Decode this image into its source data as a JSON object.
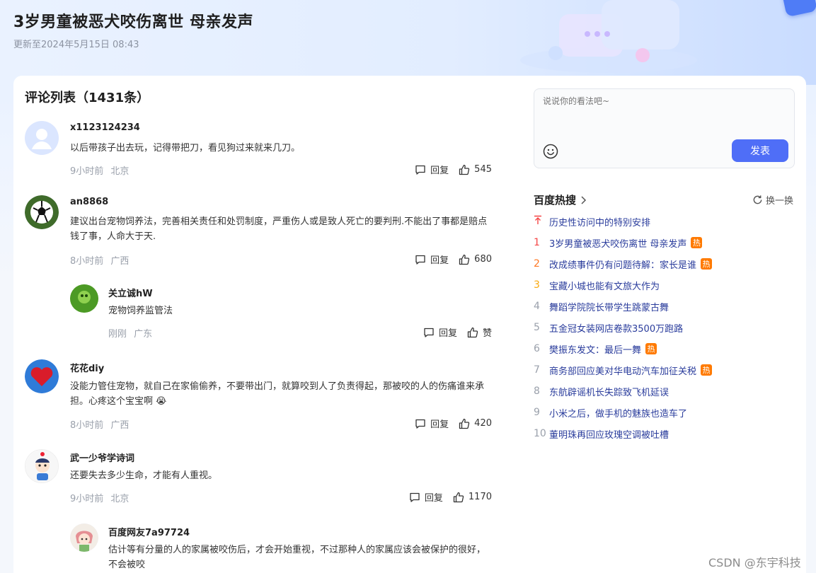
{
  "article": {
    "title": "3岁男童被恶犬咬伤离世 母亲发声",
    "updated": "更新至2024年5月15日 08:43"
  },
  "comments": {
    "title": "评论列表（1431条）",
    "reply_label": "回复",
    "items": [
      {
        "name": "x1123124234",
        "text": "以后带孩子出去玩，记得带把刀，看见狗过来就来几刀。",
        "time": "9小时前",
        "location": "北京",
        "likes": "545"
      },
      {
        "name": "an8868",
        "text": "建议出台宠物饲养法，完善相关责任和处罚制度，严重伤人或是致人死亡的要判刑.不能出了事都是赔点钱了事，人命大于天.",
        "time": "8小时前",
        "location": "广西",
        "likes": "680",
        "reply": {
          "name": "关立诚hW",
          "text": "宠物饲养监管法",
          "time": "刚刚",
          "location": "广东",
          "likes": "赞"
        }
      },
      {
        "name": "花花diy",
        "text": "没能力管住宠物，就自己在家偷偷养，不要带出门，就算咬到人了负责得起，那被咬的人的伤痛谁来承担。心疼这个宝宝啊 😭",
        "time": "8小时前",
        "location": "广西",
        "likes": "420"
      },
      {
        "name": "武一少爷学诗词",
        "text": "还要失去多少生命，才能有人重视。",
        "time": "9小时前",
        "location": "北京",
        "likes": "1170",
        "reply": {
          "name": "百度网友7a97724",
          "text": "估计等有分量的人的家属被咬伤后，才会开始重视，不过那种人的家属应该会被保护的很好，不会被咬"
        }
      }
    ]
  },
  "composer": {
    "placeholder": "说说你的看法吧~",
    "submit_label": "发表"
  },
  "hot": {
    "title": "百度热搜",
    "refresh_label": "换一换",
    "badge_label": "热",
    "items": [
      {
        "rank": "",
        "text": "历史性访问中的特别安排"
      },
      {
        "rank": "1",
        "text": "3岁男童被恶犬咬伤离世 母亲发声",
        "hot": true
      },
      {
        "rank": "2",
        "text": "改成绩事件仍有问题待解：家长是谁",
        "hot": true
      },
      {
        "rank": "3",
        "text": "宝藏小城也能有文旅大作为"
      },
      {
        "rank": "4",
        "text": "舞蹈学院院长带学生跳蒙古舞"
      },
      {
        "rank": "5",
        "text": "五金冠女装网店卷款3500万跑路"
      },
      {
        "rank": "6",
        "text": "樊振东发文：最后一舞",
        "hot": true
      },
      {
        "rank": "7",
        "text": "商务部回应美对华电动汽车加征关税",
        "hot": true
      },
      {
        "rank": "8",
        "text": "东航辟谣机长失踪致飞机延误"
      },
      {
        "rank": "9",
        "text": "小米之后，做手机的魅族也造车了"
      },
      {
        "rank": "10",
        "text": "董明珠再回应玫瑰空调被吐槽"
      }
    ]
  },
  "watermark": "CSDN @东宇科技",
  "colors": {
    "accent": "#4f6ef7",
    "hot_badge": "#ff7a00",
    "rank_top": "#f54545",
    "link": "#2a3c9c"
  }
}
